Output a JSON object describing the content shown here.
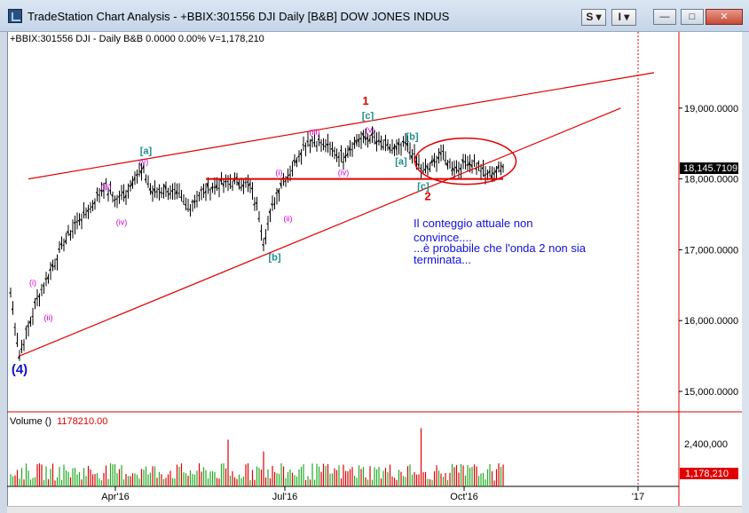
{
  "window": {
    "title": "TradeStation Chart Analysis - +BBIX:301556 DJI Daily [B&B] DOW JONES INDUS",
    "btn_s": "S ▾",
    "btn_i": "I ▾",
    "btn_min": "—",
    "btn_max": "□",
    "btn_close": "✕"
  },
  "status_line": "+BBIX:301556 DJI - Daily  B&B  0.0000  0.00%  V=1,178,210",
  "volume_label": "Volume ()",
  "volume_value": "1178210.00",
  "comment": [
    "Il conteggio attuale non",
    "convince....",
    "...è probabile che l'onda 2 non sia",
    "terminata..."
  ],
  "chart_data": {
    "type": "candlestick_bar",
    "price_axis_ticks": [
      19000,
      18000,
      17000,
      16000,
      15000
    ],
    "price_axis_labels": [
      "19,000.0000",
      "18,000.0000",
      "17,000.0000",
      "16,000.0000",
      "15,000.0000"
    ],
    "last_price": "18,145.7109",
    "volume_axis_labels": [
      "2,400,000"
    ],
    "last_volume": "1,178,210",
    "x_labels": [
      "Apr'16",
      "Jul'16",
      "Oct'16",
      "'17"
    ],
    "price_path": [
      [
        0,
        16400
      ],
      [
        4,
        15500
      ],
      [
        8,
        15900
      ],
      [
        12,
        16300
      ],
      [
        18,
        16700
      ],
      [
        24,
        17100
      ],
      [
        30,
        17400
      ],
      [
        36,
        17600
      ],
      [
        42,
        17900
      ],
      [
        48,
        17700
      ],
      [
        52,
        17800
      ],
      [
        56,
        18050
      ],
      [
        60,
        18100
      ],
      [
        64,
        17800
      ],
      [
        70,
        17850
      ],
      [
        76,
        17750
      ],
      [
        80,
        17600
      ],
      [
        86,
        17800
      ],
      [
        92,
        17900
      ],
      [
        98,
        17950
      ],
      [
        104,
        17950
      ],
      [
        108,
        17900
      ],
      [
        112,
        17500
      ],
      [
        114,
        17100
      ],
      [
        118,
        17600
      ],
      [
        122,
        17950
      ],
      [
        126,
        18100
      ],
      [
        130,
        18350
      ],
      [
        134,
        18550
      ],
      [
        140,
        18500
      ],
      [
        146,
        18400
      ],
      [
        150,
        18300
      ],
      [
        154,
        18500
      ],
      [
        158,
        18550
      ],
      [
        162,
        18600
      ],
      [
        166,
        18500
      ],
      [
        170,
        18450
      ],
      [
        174,
        18400
      ],
      [
        178,
        18500
      ],
      [
        182,
        18300
      ],
      [
        186,
        18100
      ],
      [
        190,
        18200
      ],
      [
        194,
        18350
      ],
      [
        198,
        18200
      ],
      [
        202,
        18150
      ],
      [
        206,
        18250
      ],
      [
        210,
        18200
      ],
      [
        214,
        18050
      ],
      [
        218,
        18100
      ],
      [
        222,
        18150
      ]
    ],
    "volume_spikes": [
      [
        98,
        2400000
      ],
      [
        185,
        3000000
      ],
      [
        114,
        1800000
      ]
    ],
    "trendlines": [
      {
        "from": [
          8,
          18000
        ],
        "to": [
          290,
          19500
        ],
        "color": "#e00000"
      },
      {
        "from": [
          4,
          15500
        ],
        "to": [
          275,
          19000
        ],
        "color": "#e00000"
      },
      {
        "from": [
          88,
          18000
        ],
        "to": [
          222,
          18000
        ],
        "color": "#e00000"
      }
    ],
    "annotations": {
      "purple": [
        {
          "t": "(i)",
          "at": [
            10,
            16500
          ]
        },
        {
          "t": "(ii)",
          "at": [
            17,
            16000
          ]
        },
        {
          "t": "(iii)",
          "at": [
            43,
            17850
          ]
        },
        {
          "t": "(iv)",
          "at": [
            50,
            17350
          ]
        },
        {
          "t": "(v)",
          "at": [
            60,
            18200
          ]
        },
        {
          "t": "(i)",
          "at": [
            121,
            18050
          ]
        },
        {
          "t": "(ii)",
          "at": [
            125,
            17400
          ]
        },
        {
          "t": "(iii)",
          "at": [
            137,
            18620
          ]
        },
        {
          "t": "(iv)",
          "at": [
            150,
            18050
          ]
        },
        {
          "t": "(v)",
          "at": [
            162,
            18650
          ]
        }
      ],
      "teal": [
        {
          "t": "[a]",
          "at": [
            61,
            18350
          ]
        },
        {
          "t": "[b]",
          "at": [
            119,
            16850
          ]
        },
        {
          "t": "[c]",
          "at": [
            161,
            18850
          ]
        },
        {
          "t": "[b]",
          "at": [
            181,
            18550
          ]
        },
        {
          "t": "[a]",
          "at": [
            176,
            18200
          ]
        },
        {
          "t": "[c]",
          "at": [
            186,
            17850
          ]
        }
      ],
      "red": [
        {
          "t": "1",
          "at": [
            160,
            19050
          ]
        },
        {
          "t": "2",
          "at": [
            188,
            17700
          ]
        }
      ],
      "blue": [
        {
          "t": "(4)",
          "at": [
            4,
            15250
          ]
        }
      ]
    },
    "ellipse_highlight": {
      "center": [
        205,
        18250
      ],
      "color": "#e00000"
    }
  }
}
